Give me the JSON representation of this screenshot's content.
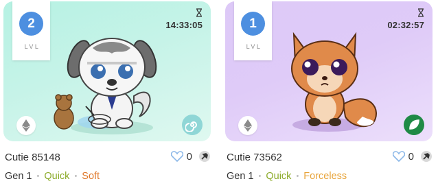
{
  "cards": [
    {
      "level": "2",
      "level_label": "LVL",
      "timer": "14:33:05",
      "name": "Cutie 85148",
      "likes": "0",
      "gen": "Gen 1",
      "trait1": "Quick",
      "trait2": "Soft",
      "bg_color": "#c6f3e8",
      "type_icon": "spiral-icon"
    },
    {
      "level": "1",
      "level_label": "LVL",
      "timer": "02:32:57",
      "name": "Cutie 73562",
      "likes": "0",
      "gen": "Gen 1",
      "trait1": "Quick",
      "trait2": "Forceless",
      "bg_color": "#dfcbf8",
      "type_icon": "leaf-icon"
    }
  ],
  "colors": {
    "level_badge": "#4d8fe0",
    "quick": "#8cab2a",
    "soft": "#e0782a",
    "forceless": "#e8a43a"
  }
}
